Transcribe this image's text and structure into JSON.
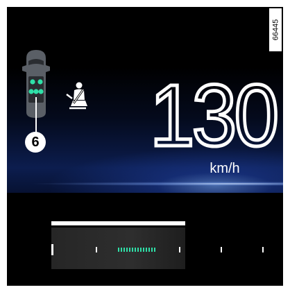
{
  "reference": {
    "number": "66445"
  },
  "display": {
    "speed": {
      "value": "130",
      "unit": "km/h"
    },
    "callout": {
      "label": "6"
    }
  },
  "icons": {
    "car": "car-top-view-seat-occupancy-icon",
    "seatbelt": "seatbelt-reminder-icon"
  },
  "colors": {
    "background": "#000000",
    "text": "#ffffff",
    "seat_indicator": "#2fe0a8",
    "glow": "#3a6fe0"
  }
}
